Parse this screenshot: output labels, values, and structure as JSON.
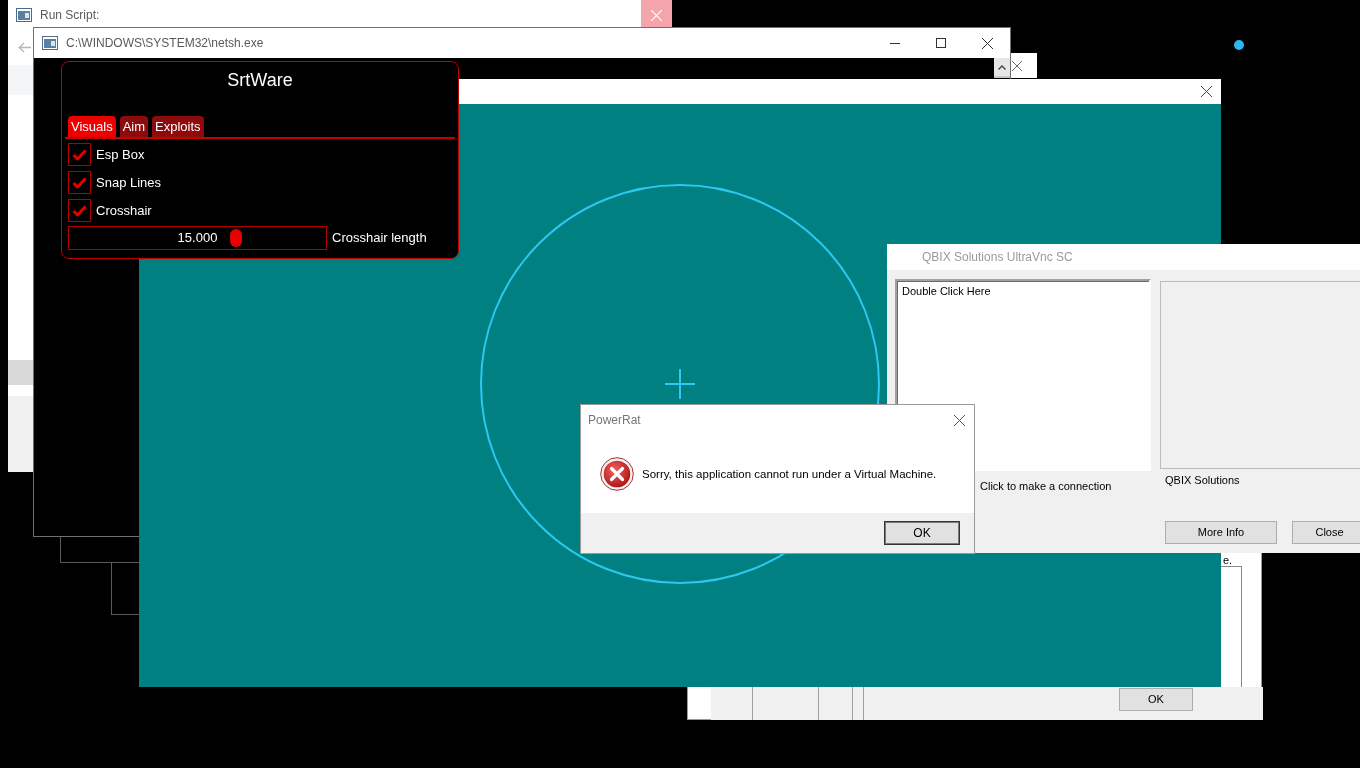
{
  "run_script_window": {
    "title": "Run Script:"
  },
  "console_window": {
    "title": "C:\\WINDOWS\\SYSTEM32\\netsh.exe"
  },
  "back_window": {
    "text": "e.",
    "button": "OK"
  },
  "srtware": {
    "title": "SrtWare",
    "tabs": [
      {
        "label": "Visuals",
        "selected": true
      },
      {
        "label": "Aim",
        "selected": false
      },
      {
        "label": "Exploits",
        "selected": false
      }
    ],
    "options": [
      {
        "label": "Esp Box",
        "checked": true
      },
      {
        "label": "Snap Lines",
        "checked": true
      },
      {
        "label": "Crosshair",
        "checked": true
      }
    ],
    "slider": {
      "value": "15.000",
      "level": 0.66,
      "label": "Crosshair length"
    }
  },
  "vnc_window": {
    "title": "QBIX Solutions UltraVnc SC",
    "list_items": [
      "Double Click Here"
    ],
    "hint": "Click to make a connection",
    "vendor": "QBIX Solutions",
    "buttons": [
      "More Info",
      "Close"
    ]
  },
  "message_box": {
    "title": "PowerRat",
    "message": "Sorry, this application cannot run under a Virtual Machine.",
    "buttons": [
      "OK"
    ]
  }
}
